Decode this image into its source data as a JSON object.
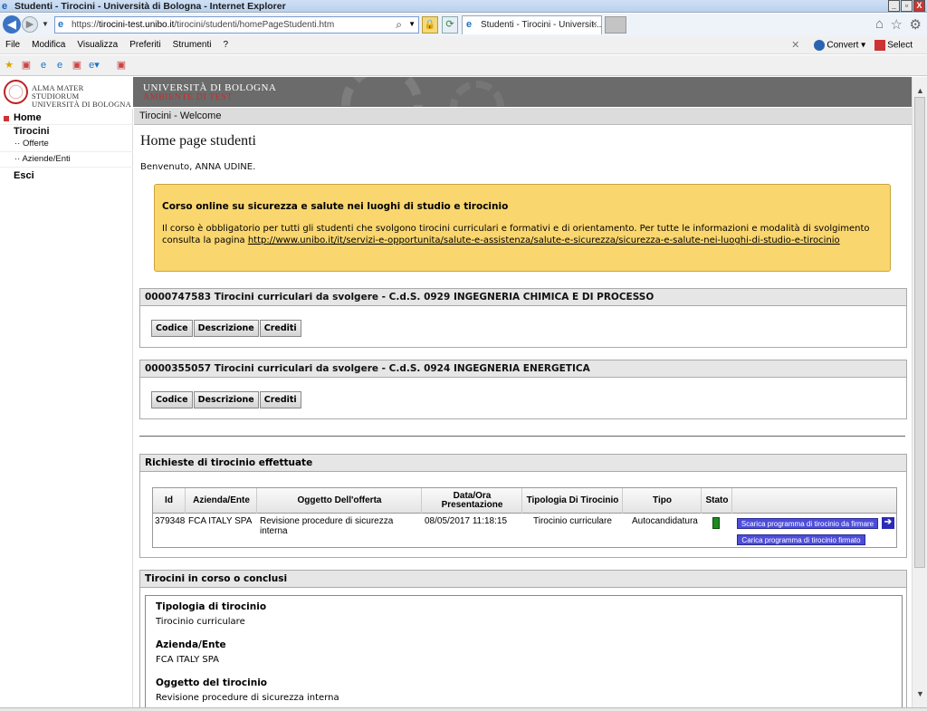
{
  "window": {
    "title": "Studenti - Tirocini - Università di Bologna - Internet Explorer",
    "buttons": [
      "_",
      "▫",
      "X"
    ]
  },
  "addressbar": {
    "url_prefix": "https://",
    "url_host": "tirocini-test.unibo.it",
    "url_path": "/tirocini/studenti/homePageStudenti.htm",
    "tab_label": "Studenti - Tirocini - Universit..."
  },
  "menubar": {
    "items": [
      "File",
      "Modifica",
      "Visualizza",
      "Preferiti",
      "Strumenti",
      "?"
    ],
    "convert_label": "Convert",
    "select_label": "Select"
  },
  "header": {
    "alma_line1": "ALMA MATER STUDIORUM",
    "alma_line2": "UNIVERSITÀ DI BOLOGNA",
    "banner_uni": "UNIVERSITÀ DI BOLOGNA",
    "banner_env": "AMBIENTE DI TEST"
  },
  "sidebar": {
    "home": "Home",
    "tirocini": "Tirocini",
    "offerte": "·· Offerte",
    "aziende": "·· Aziende/Enti",
    "esci": "Esci"
  },
  "main": {
    "breadcrumb": "Tirocini - Welcome",
    "title": "Home page studenti",
    "welcome": "Benvenuto, ANNA UDINE.",
    "alert": {
      "title": "Corso online su sicurezza e salute nei luoghi di studio e tirocinio",
      "text": "Il corso è obbligatorio per tutti gli studenti che svolgono tirocini curriculari e formativi e di orientamento. Per tutte le informazioni e modalità di svolgimento consulta la pagina ",
      "link": "http://www.unibo.it/it/servizi-e-opportunita/salute-e-assistenza/salute-e-sicurezza/sicurezza-e-salute-nei-luoghi-di-studio-e-tirocinio"
    },
    "cds": [
      {
        "header": "0000747583 Tirocini curriculari da svolgere - C.d.S. 0929 INGEGNERIA CHIMICA E DI PROCESSO"
      },
      {
        "header": "0000355057 Tirocini curriculari da svolgere - C.d.S. 0924 INGEGNERIA ENERGETICA"
      }
    ],
    "cds_buttons": [
      "Codice",
      "Descrizione",
      "Crediti"
    ],
    "requests": {
      "header": "Richieste di tirocinio effettuate",
      "columns": [
        "Id",
        "Azienda/Ente",
        "Oggetto Dell'offerta",
        "Data/Ora Presentazione",
        "Tipologia Di Tirocinio",
        "Tipo",
        "Stato"
      ],
      "row": {
        "id": "379348",
        "azienda": "FCA ITALY SPA",
        "oggetto": "Revisione procedure di sicurezza interna",
        "data": "08/05/2017 11:18:15",
        "tipologia": "Tirocinio curriculare",
        "tipo": "Autocandidatura",
        "stato_color": "#1f8a1f"
      },
      "btn_download": "Scarica programma di tirocinio da firmare",
      "btn_upload": "Carica programma di tirocinio firmato"
    },
    "current": {
      "header": "Tirocini in corso o conclusi",
      "fields": [
        {
          "label": "Tipologia di tirocinio",
          "value": "Tirocinio curriculare"
        },
        {
          "label": "Azienda/Ente",
          "value": "FCA ITALY SPA"
        },
        {
          "label": "Oggetto del tirocinio",
          "value": "Revisione procedure di sicurezza interna"
        }
      ]
    }
  }
}
